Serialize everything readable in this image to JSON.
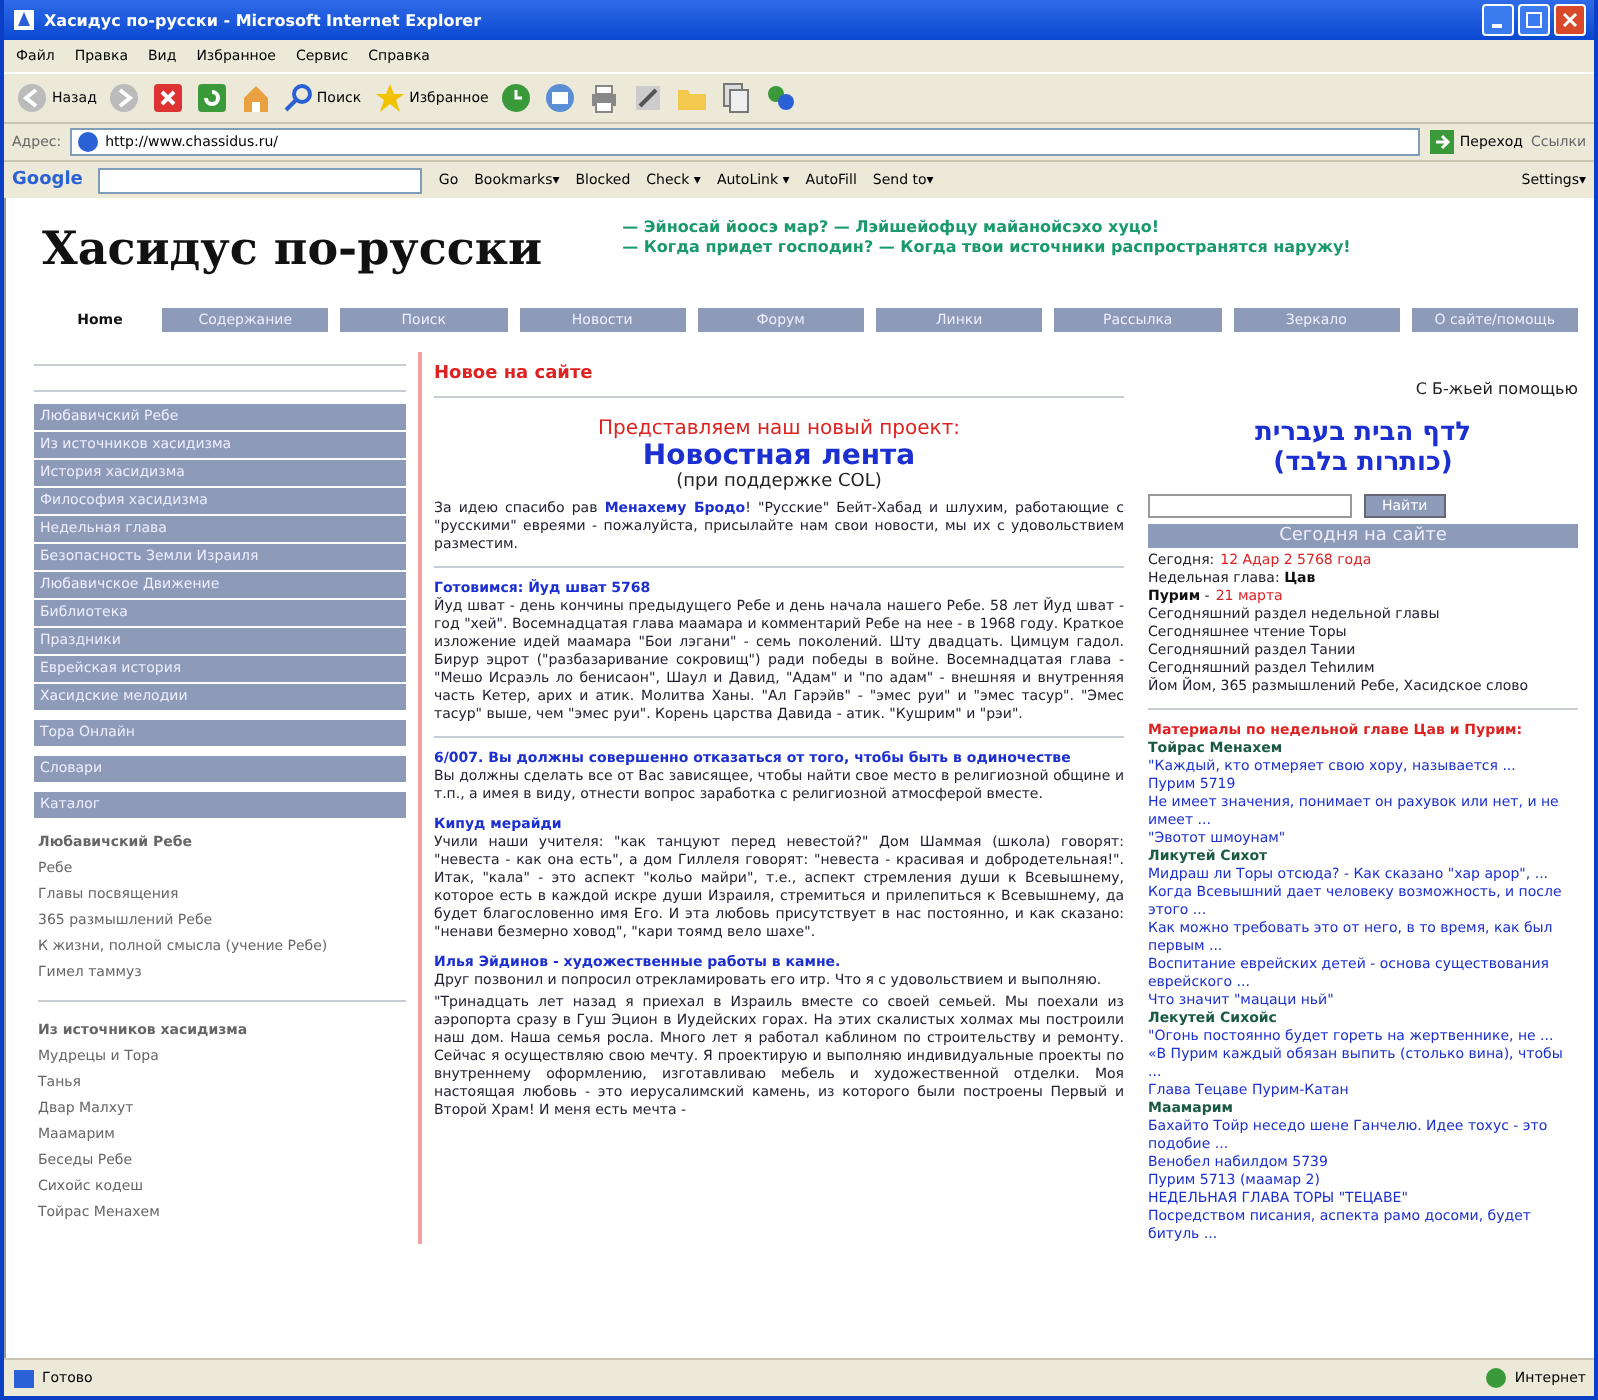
{
  "window": {
    "title": "Хасидус по-русски - Microsoft Internet Explorer"
  },
  "menu": [
    "Файл",
    "Правка",
    "Вид",
    "Избранное",
    "Сервис",
    "Справка"
  ],
  "toolbar": {
    "back": "Назад",
    "search": "Поиск",
    "favorites": "Избранное"
  },
  "address": {
    "label": "Адрес:",
    "url": "http://www.chassidus.ru/",
    "go": "Переход",
    "links": "Ссылки"
  },
  "google_toolbar": {
    "logo": "Google",
    "items": [
      "Go",
      "Bookmarks▾",
      "Blocked",
      "Check ▾",
      "AutoLink ▾",
      "AutoFill",
      "Send to▾"
    ],
    "settings": "Settings▾"
  },
  "header": {
    "title": "Хасидус по-русски",
    "motto": [
      "— Эйносай йоосэ мар? — Лэйшейофцу майанойсэхо хуцо!",
      "— Когда придет господин? — Когда твои источники распространятся наружу!"
    ]
  },
  "nav": [
    {
      "label": "Home",
      "selected": true
    },
    {
      "label": "Содержание",
      "selected": false
    },
    {
      "label": "Поиск",
      "selected": false
    },
    {
      "label": "Новости",
      "selected": false
    },
    {
      "label": "Форум",
      "selected": false
    },
    {
      "label": "Линки",
      "selected": false
    },
    {
      "label": "Рассылка",
      "selected": false
    },
    {
      "label": "Зеркало",
      "selected": false
    },
    {
      "label": "О сайте/помощь",
      "selected": false
    }
  ],
  "sidebar": {
    "sections": [
      [
        "Любавичский Ребе",
        "Из источников хасидизма",
        "История хасидизма",
        "Философия хасидизма",
        "Недельная глава",
        "Безопасность Земли Израиля",
        "Любавичское Движение",
        "Библиотека",
        "Праздники",
        "Еврейская история",
        "Хасидские мелодии"
      ],
      [
        "Тора Онлайн"
      ],
      [
        "Словари"
      ],
      [
        "Каталог"
      ]
    ],
    "link_groups": [
      [
        {
          "text": "Любавичский Ребе",
          "bold": true
        },
        {
          "text": "Ребе",
          "bold": false
        },
        {
          "text": "Главы посвящения",
          "bold": false
        },
        {
          "text": "365 размышлений Ребе",
          "bold": false
        },
        {
          "text": "К жизни, полной смысла (учение Ребе)",
          "bold": false
        },
        {
          "text": "Гимел таммуз",
          "bold": false
        }
      ],
      [
        {
          "text": "Из источников хасидизма",
          "bold": true
        },
        {
          "text": "Мудрецы и Тора",
          "bold": false
        },
        {
          "text": "Танья",
          "bold": false
        },
        {
          "text": "Двар Малхут",
          "bold": false
        },
        {
          "text": "Маамарим",
          "bold": false
        },
        {
          "text": "Беседы Ребе",
          "bold": false
        },
        {
          "text": "Сихойс кодеш",
          "bold": false
        },
        {
          "text": "Тойрас Менахем",
          "bold": false
        }
      ]
    ]
  },
  "news": {
    "heading": "Новое на сайте",
    "promo": {
      "intro": "Представляем наш новый проект:",
      "title": "Новостная лента",
      "note": "(при поддержке COL)",
      "text": "За идею спасибо рав **Менахему Бродо**! \"Русские\" Бейт-Хабад и шлухим, работающие с \"русскими\" евреями - пожалуйста, присылайте нам свои новости, мы их с удовольствием разместим."
    },
    "items": [
      {
        "title": "Готовимся: Йуд шват 5768",
        "paragraphs": [
          "Йуд шват - день кончины предыдущего Ребе и день начала нашего Ребе. 58 лет Йуд шват - год \"хей\". Восемнадцатая глава маамара и комментарий Ребе на нее - в 1968 году. Краткое изложение идей маамара \"Бои лэгани\" - семь поколений. Шту двадцать. Цимцум гадол. Бирур эцрот (\"разбазаривание сокровищ\") ради победы в войне. Восемнадцатая глава - \"Мешо Исраэль ло бенисаон\", Шаул и Давид, \"Адам\" и \"по адам\" - внешняя и внутренняя часть Кетер, арих и атик. Молитва Ханы. \"Ал Гарэйв\" - \"эмес руи\" и \"эмес тасур\". \"Эмес тасур\" выше, чем \"эмес руи\". Корень царства Давида - атик. \"Кушрим\" и \"рэи\"."
        ],
        "divider": true
      },
      {
        "title": "6/007. Вы должны совершенно отказаться от того, чтобы быть в одиночестве",
        "paragraphs": [
          "Вы должны сделать все от Вас зависящее, чтобы найти свое место в религиозной общине и т.п., а имея в виду, отнести вопрос заработка с религиозной атмосферой вместе."
        ],
        "divider": false
      },
      {
        "title": "Кипуд мерайди",
        "paragraphs": [
          "Учили наши учителя: \"как танцуют перед невестой?\" Дом Шаммая (школа) говорят: \"невеста - как она есть\", а дом Гиллеля говорят: \"невеста - красивая и добродетельная!\". Итак, \"кала\" - это аспект \"кольо майри\", т.е., аспект стремления души к Всевышнему, которое есть в каждой искре души Израиля, стремиться и прилепиться к Всевышнему, да будет благословенно имя Его. И эта любовь присутствует в нас постоянно, и как сказано: \"ненави безмерно ховод\", \"кари тоямд вело шахе\"."
        ],
        "divider": false
      },
      {
        "title": "Илья Эйдинов - художественные работы в камне.",
        "paragraphs": [
          "Друг позвонил и попросил отрекламировать его итр. Что я с удовольствием и выполняю.",
          "\"Тринадцать лет назад я приехал в Израиль вместе со своей семьей. Мы поехали из аэропорта сразу в Гуш Эцион в Иудейских горах. На этих скалистых холмах мы построили наш дом. Наша семья росла. Много лет я работал каблином по строительству и ремонту. Сейчас я осуществляю свою мечту. Я проектирую и выполняю индивидуальные проекты по внутреннему оформлению, изготавливаю мебель и художественной отделки. Моя настоящая любовь - это иерусалимский камень, из которого были построены Первый и Второй Храм! И меня есть мечта -"
        ],
        "divider": false
      }
    ]
  },
  "right": {
    "blessing": "С Б-жьей помощью",
    "hebrew_link": [
      "לדף הבית בעברית",
      "(כותרות בלבד)"
    ],
    "search": {
      "button": "Найти"
    },
    "today": {
      "title": "Сегодня на сайте",
      "items": [
        {
          "text": "Сегодня:",
          "highlight": "12 Адар 2 5768 года"
        },
        {
          "text": "Недельная глава: **Цав**"
        },
        {
          "text": "**Пурим** -",
          "highlight": "21 марта"
        },
        {
          "text": "Сегодняшний раздел недельной главы"
        },
        {
          "text": "Сегодняшнее чтение Торы"
        },
        {
          "text": "Сегодняшний раздел Тании"
        },
        {
          "text": "Сегодняшний раздел Теhилим"
        },
        {
          "text": "Йом Йом, 365 размышлений Ребе, Хасидское слово"
        }
      ]
    },
    "materials": {
      "title": "Материалы по недельной главе Цав и Пурим:",
      "items": [
        {
          "kind": "heading",
          "text": "Тойрас Менахем"
        },
        {
          "kind": "link",
          "text": "\"Каждый, кто отмеряет свою хору, называется ..."
        },
        {
          "kind": "link",
          "text": "Пурим 5719"
        },
        {
          "kind": "link",
          "text": "Не имеет значения, понимает он рахувок или нет, и не имеет ..."
        },
        {
          "kind": "link",
          "text": "\"Эвотот шмоунам\""
        },
        {
          "kind": "heading",
          "text": "Ликутей Сихот"
        },
        {
          "kind": "link",
          "text": "Мидраш ли Торы отсюда? - Как сказано \"хар арор\", ..."
        },
        {
          "kind": "link",
          "text": "Когда Всевышний дает человеку возможность, и после этого ..."
        },
        {
          "kind": "link",
          "text": "Как можно требовать это от него, в то время, как был первым ..."
        },
        {
          "kind": "link",
          "text": "Воспитание еврейских детей - основа существования еврейского ..."
        },
        {
          "kind": "link",
          "text": "Что значит \"мацаци ньй\""
        },
        {
          "kind": "heading",
          "text": "Лекутей Сихойс"
        },
        {
          "kind": "link",
          "text": "\"Огонь постоянно будет гореть на жертвеннике, не ..."
        },
        {
          "kind": "link",
          "text": "«В Пурим каждый обязан выпить (столько вина), чтобы ..."
        },
        {
          "kind": "link",
          "text": "Глава Тецаве Пурим-Катан"
        },
        {
          "kind": "heading",
          "text": "Маамарим"
        },
        {
          "kind": "link",
          "text": "Бахайто Тойр неседо шене Ганчелю. Идее тохус - это подобие ..."
        },
        {
          "kind": "link",
          "text": "Венобел набилдом 5739"
        },
        {
          "kind": "link",
          "text": "Пурим 5713 (маамар 2)"
        },
        {
          "kind": "link",
          "text": "НЕДЕЛЬНАЯ ГЛАВА ТОРЫ \"ТЕЦАВЕ\""
        },
        {
          "kind": "link",
          "text": "Посредством писания, аспекта рамо досоми, будет битуль ..."
        }
      ]
    }
  },
  "status_bar": {
    "text": "Готово",
    "zone": "Интернет"
  }
}
